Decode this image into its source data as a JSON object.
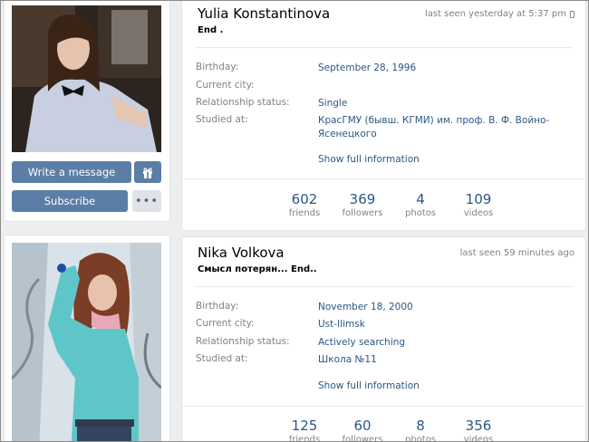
{
  "profiles": [
    {
      "name": "Yulia Konstantinova",
      "status": "End .",
      "last_seen": "last seen yesterday at 5:37 pm",
      "info": [
        {
          "label": "Birthday:",
          "value": "September 28, 1996"
        },
        {
          "label": "Current city:",
          "value": ""
        },
        {
          "label": "Relationship status:",
          "value": "Single"
        },
        {
          "label": "Studied at:",
          "value": "КрасГМУ (бывш. КГМИ) им. проф. В. Ф. Войно-Ясенецкого"
        }
      ],
      "show_full": "Show full information",
      "counters": [
        {
          "num": "602",
          "cap": "friends"
        },
        {
          "num": "369",
          "cap": "followers"
        },
        {
          "num": "4",
          "cap": "photos"
        },
        {
          "num": "109",
          "cap": "videos"
        }
      ],
      "buttons": {
        "write": "Write a message",
        "subscribe": "Subscribe",
        "more": "•••"
      }
    },
    {
      "name": "Nika Volkova",
      "status": "Смысл потерян... End..",
      "last_seen": "last seen 59 minutes ago",
      "info": [
        {
          "label": "Birthday:",
          "value": "November 18, 2000"
        },
        {
          "label": "Current city:",
          "value": "Ust-Ilimsk"
        },
        {
          "label": "Relationship status:",
          "value": "Actively searching"
        },
        {
          "label": "Studied at:",
          "value": "Школа №11"
        }
      ],
      "show_full": "Show full information",
      "counters": [
        {
          "num": "125",
          "cap": "friends"
        },
        {
          "num": "60",
          "cap": "followers"
        },
        {
          "num": "8",
          "cap": "photos"
        },
        {
          "num": "356",
          "cap": "videos"
        }
      ]
    }
  ],
  "colors": {
    "accent": "#5b7ea6",
    "link": "#2a5885",
    "muted": "#828282",
    "background": "#edeef0"
  }
}
